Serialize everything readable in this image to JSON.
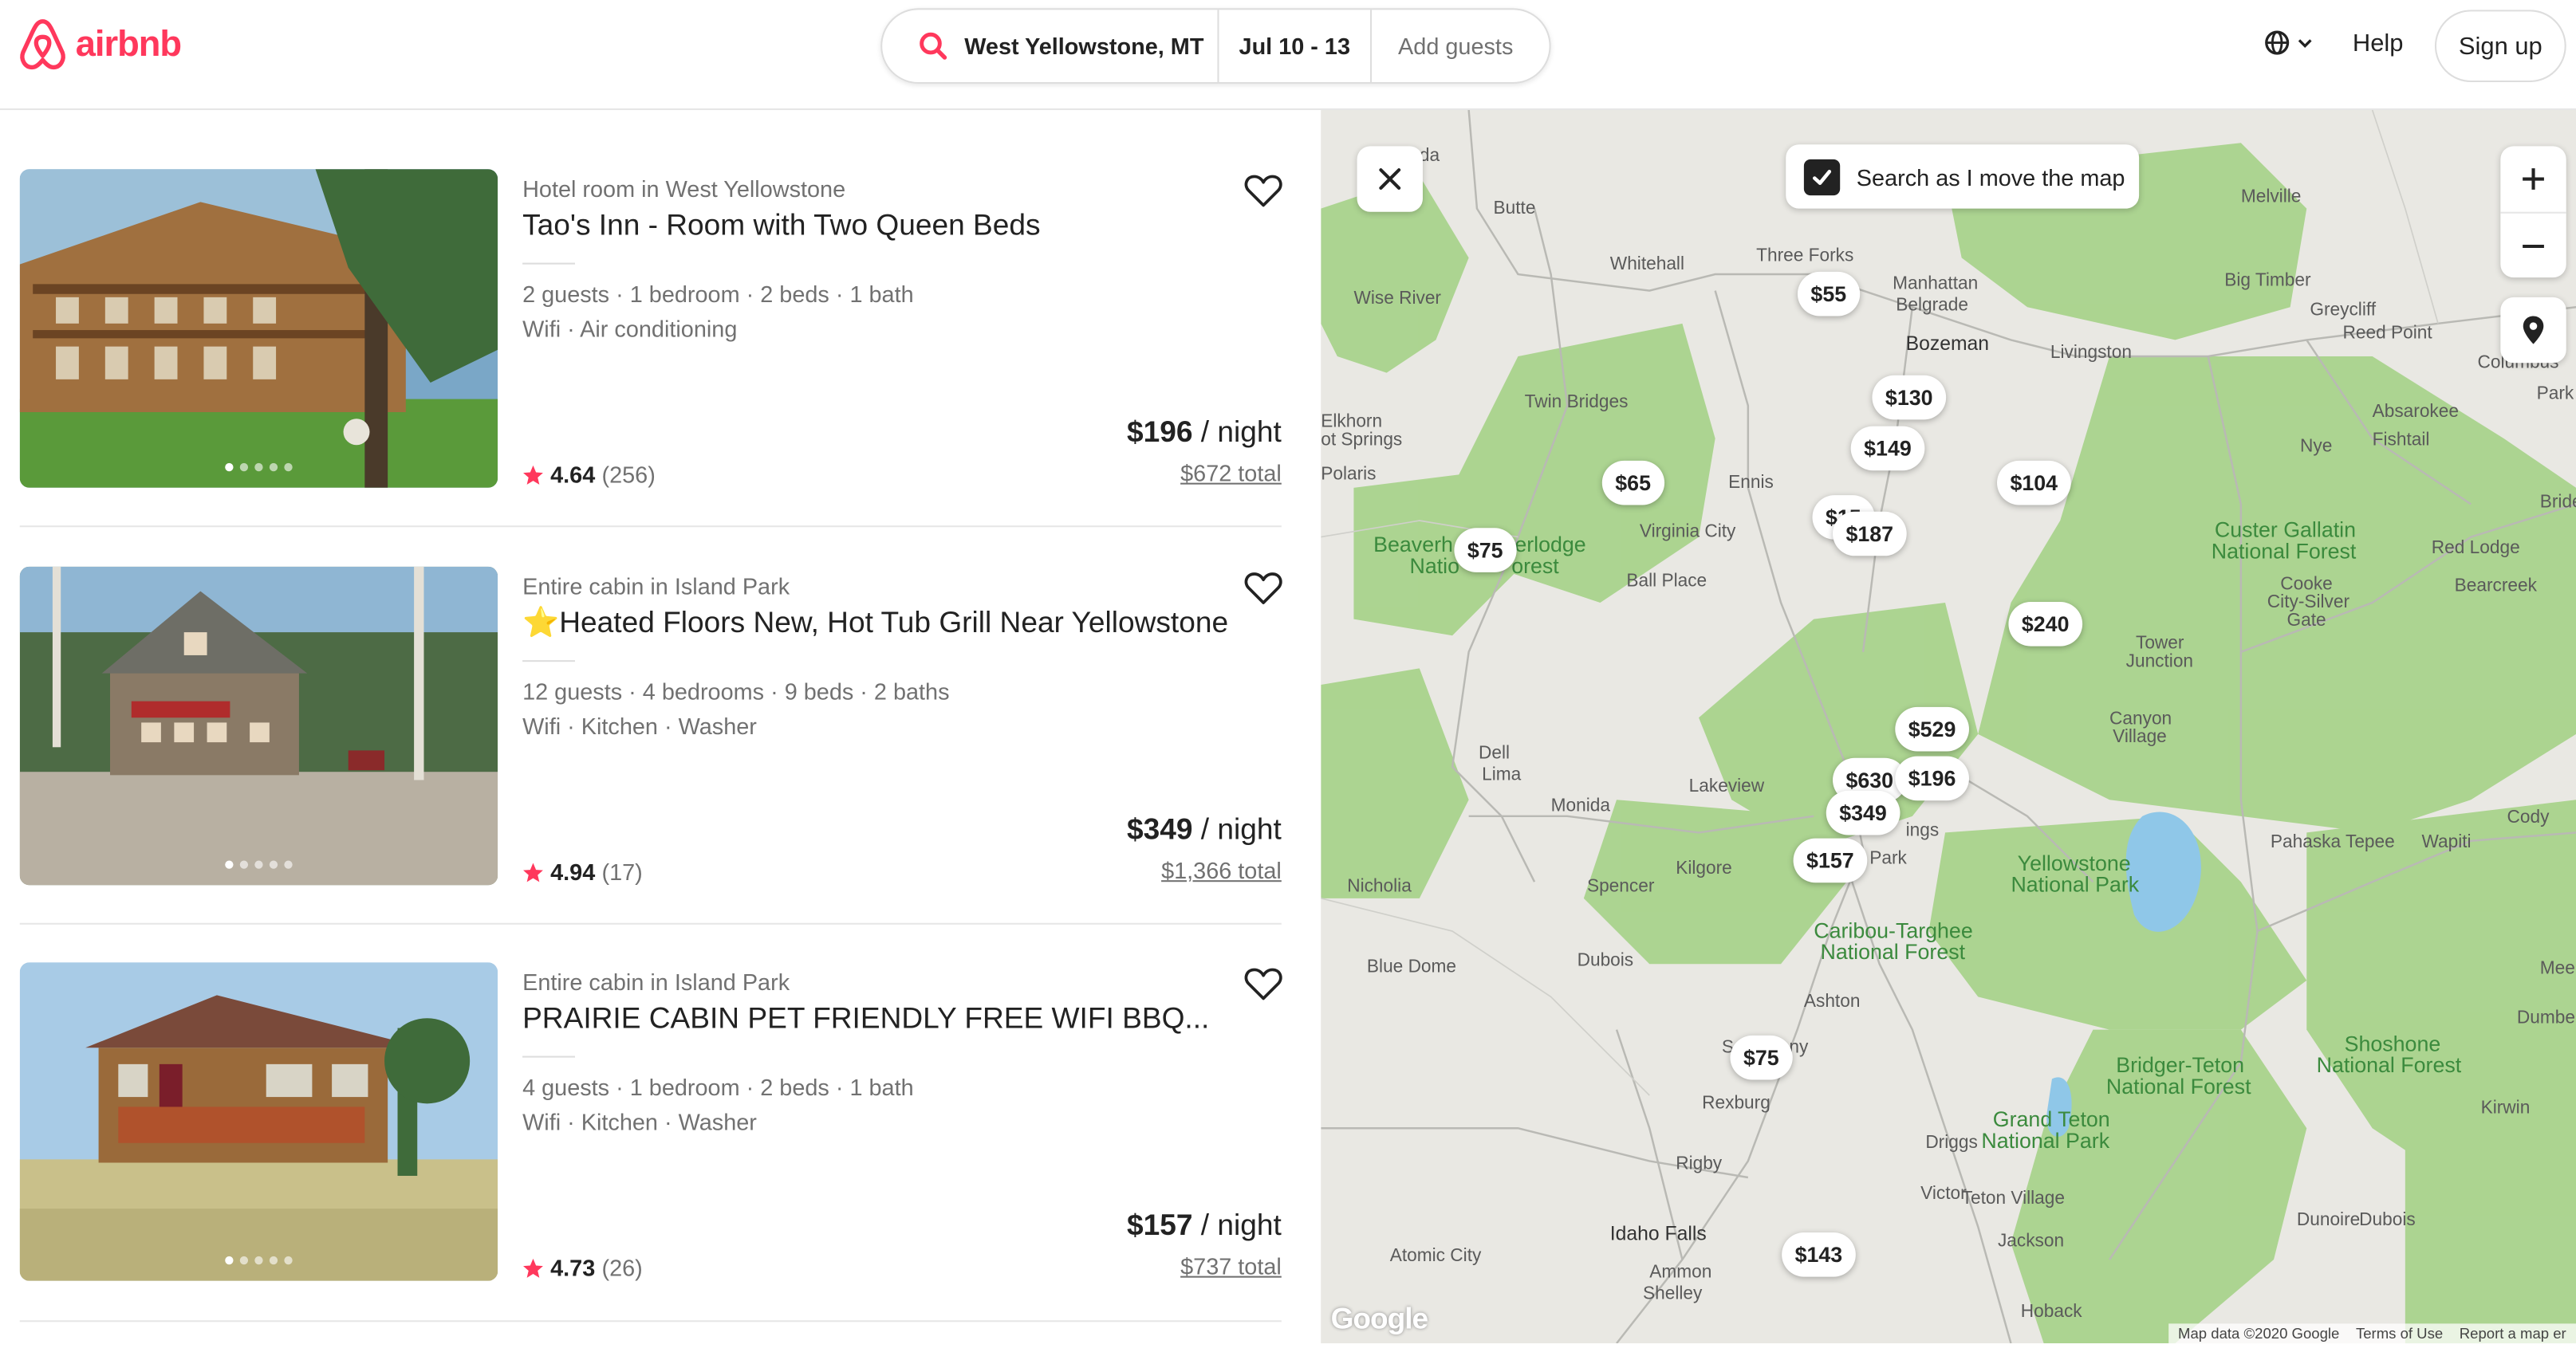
{
  "brand": {
    "name": "airbnb",
    "color": "#ff385c"
  },
  "search": {
    "location": "West Yellowstone, MT",
    "dates": "Jul 10 - 13",
    "guests_placeholder": "Add guests"
  },
  "nav": {
    "help": "Help",
    "signup": "Sign up",
    "language_icon": "globe-icon"
  },
  "listings": [
    {
      "type": "Hotel room in West Yellowstone",
      "title": "Tao's Inn - Room with Two Queen Beds",
      "details": "2 guests · 1 bedroom · 2 beds · 1 bath",
      "amenities": "Wifi · Air conditioning",
      "rating": "4.64",
      "reviews": "(256)",
      "price": "$196",
      "per": " / night",
      "total": "$672 total"
    },
    {
      "type": "Entire cabin in Island Park",
      "title": "⭐️Heated Floors New, Hot Tub Grill Near Yellowstone",
      "details": "12 guests · 4 bedrooms · 9 beds · 2 baths",
      "amenities": "Wifi · Kitchen · Washer",
      "rating": "4.94",
      "reviews": "(17)",
      "price": "$349",
      "per": " / night",
      "total": "$1,366 total"
    },
    {
      "type": "Entire cabin in Island Park",
      "title": "PRAIRIE CABIN PET FRIENDLY FREE WIFI BBQ...",
      "details": "4 guests · 1 bedroom · 2 beds · 1 bath",
      "amenities": "Wifi · Kitchen · Washer",
      "rating": "4.73",
      "reviews": "(26)",
      "price": "$157",
      "per": " / night",
      "total": "$737 total"
    }
  ],
  "map": {
    "search_as_move": "Search as I move the map",
    "search_as_move_checked": true,
    "attribution": "Map data ©2020 Google",
    "terms": "Terms of Use",
    "report": "Report a map er",
    "google": "Google",
    "prices": [
      "$55",
      "$130",
      "$149",
      "$104",
      "$65",
      "$75",
      "$15",
      "$187",
      "$240",
      "$529",
      "$630",
      "$196",
      "$349",
      "$157",
      "$75",
      "$143"
    ],
    "places": [
      "Butte",
      "Whitehall",
      "Three Forks",
      "Manhattan",
      "Belgrade",
      "Bozeman",
      "Livingston",
      "Wise River",
      "Big Timber",
      "Greycliff",
      "Reed Point",
      "Columbus",
      "Melville",
      "Twin Bridges",
      "Elkhorn",
      "ot Springs",
      "Polaris",
      "Ennis",
      "Virginia City",
      "Ball Place",
      "Nye",
      "Absarokee",
      "Fishtail",
      "Park",
      "Bride",
      "Red Lodge",
      "Bearcreek",
      "Cooke",
      "City-Silver",
      "Gate",
      "Tower",
      "Junction",
      "Canyon",
      "Village",
      "Dell",
      "Lima",
      "Monida",
      "Lakeview",
      "Kilgore",
      "Spencer",
      "Nicholia",
      "ings",
      "Park",
      "Pahaska Tepee",
      "Wapiti",
      "Cody",
      "Blue Dome",
      "Dubois",
      "Ashton",
      "S",
      "ny",
      "Rexburg",
      "Driggs",
      "Rigby",
      "Victor",
      "Teton Village",
      "Jackson",
      "Idaho Falls",
      "Atomic City",
      "Ammon",
      "Shelley",
      "Hoback",
      "Dunoire",
      "Dubois",
      "Kirwin",
      "Mee",
      "Dumbel",
      "da"
    ],
    "parks": [
      "Beaverh",
      "erlodge",
      "Natio",
      "orest",
      "Custer Gallatin",
      "National Forest",
      "Yellowstone",
      "National Park",
      "Caribou-Targhee",
      "National Forest",
      "Bridger-Teton",
      "National Forest",
      "Shoshone",
      "National Forest",
      "Grand Teton",
      "National Park"
    ]
  }
}
